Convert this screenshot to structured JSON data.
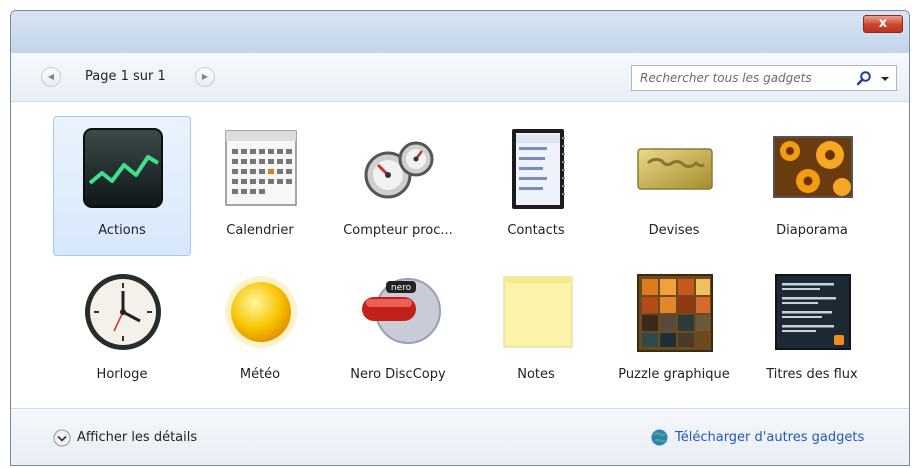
{
  "window": {
    "close_label": "x"
  },
  "toolbar": {
    "page_label": "Page 1 sur 1",
    "search_placeholder": "Rechercher tous les gadgets"
  },
  "gadgets": [
    {
      "label": "Actions",
      "icon": "stock-chart-icon",
      "selected": true
    },
    {
      "label": "Calendrier",
      "icon": "calendar-icon",
      "selected": false
    },
    {
      "label": "Compteur proc...",
      "icon": "cpu-meter-icon",
      "selected": false
    },
    {
      "label": "Contacts",
      "icon": "contacts-icon",
      "selected": false
    },
    {
      "label": "Devises",
      "icon": "currency-icon",
      "selected": false
    },
    {
      "label": "Diaporama",
      "icon": "slideshow-icon",
      "selected": false
    },
    {
      "label": "Horloge",
      "icon": "clock-icon",
      "selected": false
    },
    {
      "label": "Météo",
      "icon": "weather-sun-icon",
      "selected": false
    },
    {
      "label": "Nero DiscCopy",
      "icon": "nero-disc-icon",
      "selected": false
    },
    {
      "label": "Notes",
      "icon": "sticky-note-icon",
      "selected": false
    },
    {
      "label": "Puzzle graphique",
      "icon": "picture-puzzle-icon",
      "selected": false
    },
    {
      "label": "Titres des flux",
      "icon": "feed-headlines-icon",
      "selected": false
    }
  ],
  "footer": {
    "details_label": "Afficher les détails",
    "download_label": "Télécharger d'autres gadgets"
  },
  "colors": {
    "selection": "#d7e8fb",
    "link": "#1e5ab4",
    "titlebar": "#c3d5ea"
  }
}
